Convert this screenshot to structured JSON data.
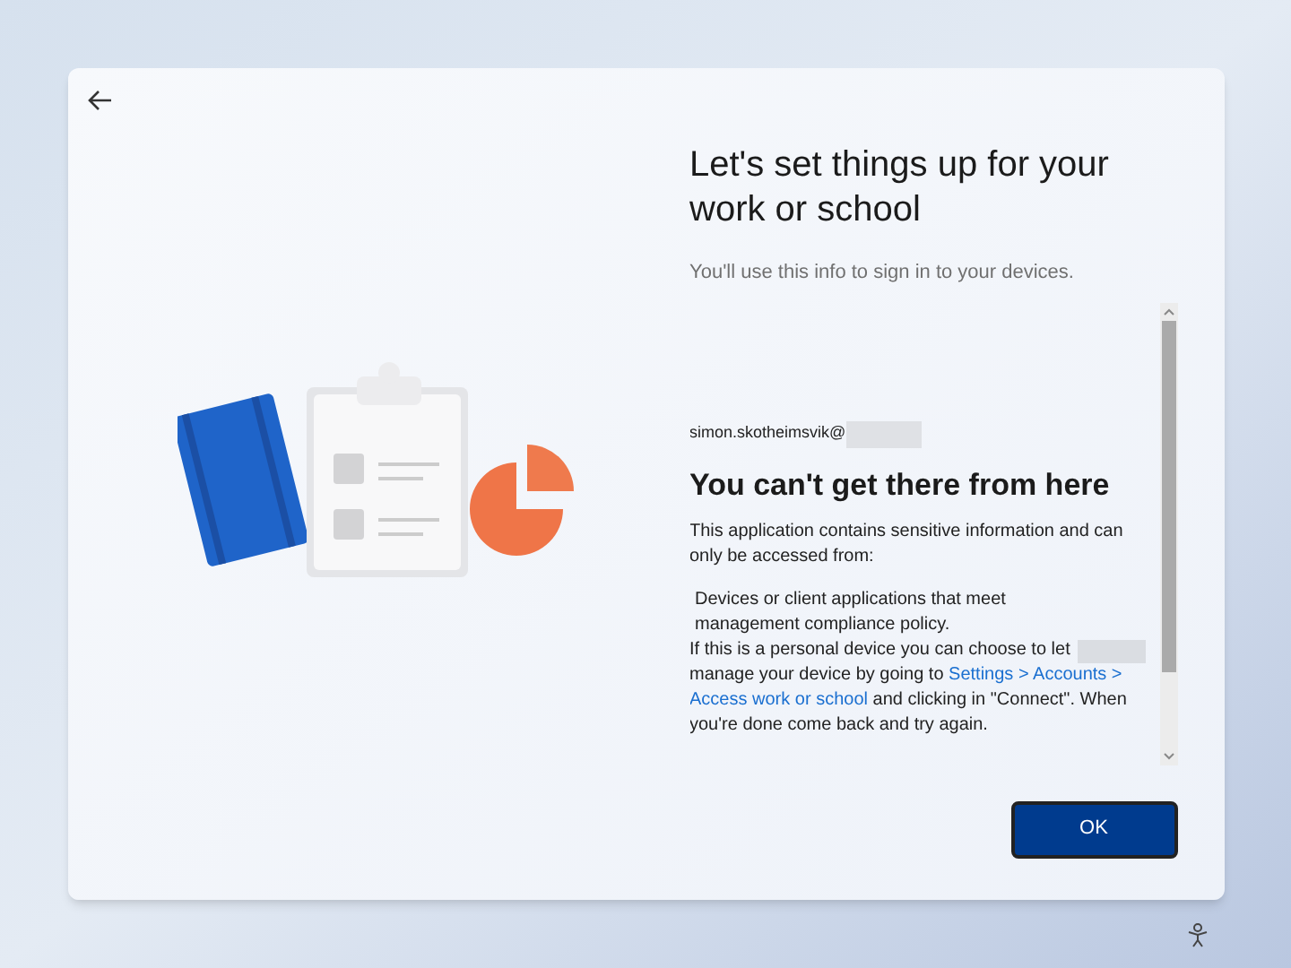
{
  "title": "Let's set things up for your work or school",
  "subtitle": "You'll use this info to sign in to your devices.",
  "account": "simon.skotheimsvik@",
  "error_title": "You can't get there from here",
  "message": "This application contains sensitive information and can only be accessed from:",
  "requirement": "Devices or client applications that meet management compliance policy.",
  "instructions": {
    "before": "If this is a personal device you can choose to let",
    "middle": "manage your device by going to",
    "link": [
      "Settings > Accounts >",
      "Access work or school"
    ],
    "after": "and clicking in \"Connect\". When you're done come back and try again."
  },
  "buttons": [
    {
      "label": "OK"
    }
  ]
}
